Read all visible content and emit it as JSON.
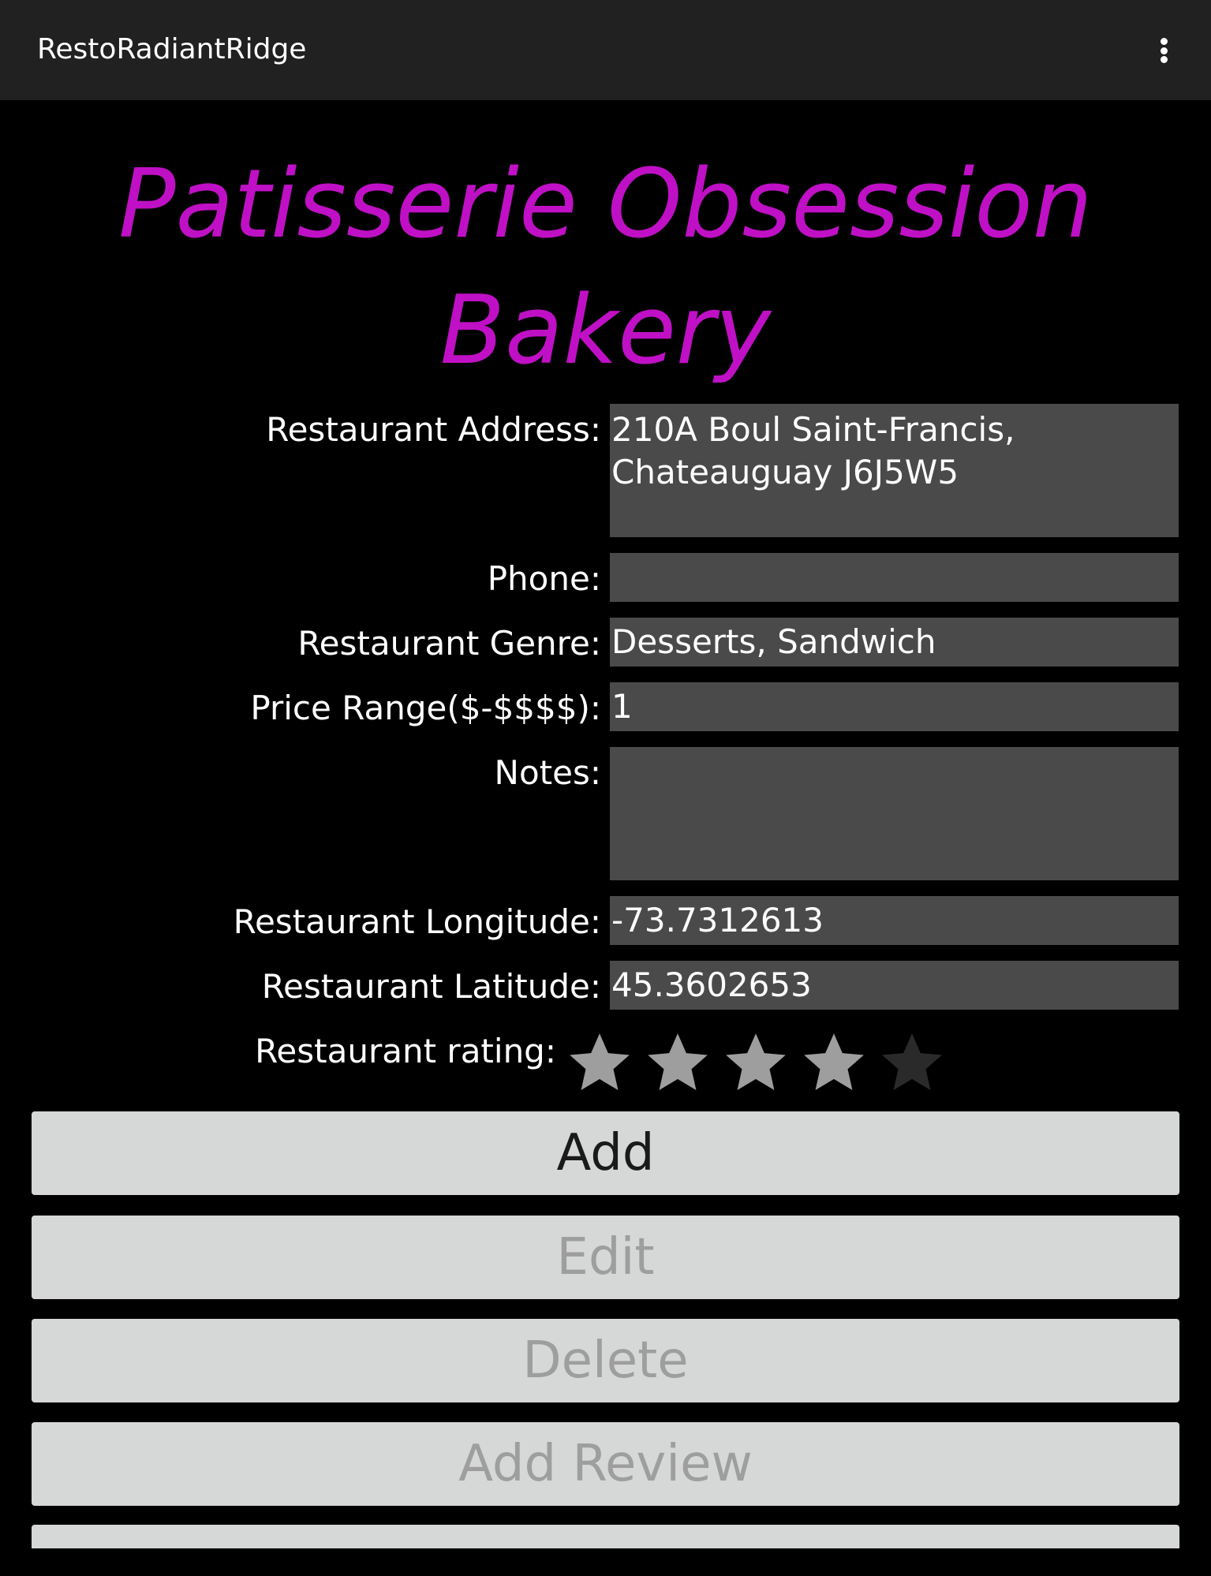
{
  "app": {
    "title": "RestoRadiantRidge"
  },
  "restaurant": {
    "name": "Patisserie Obsession Bakery"
  },
  "form": {
    "address_label": "Restaurant Address:",
    "address_value": "210A Boul Saint-Francis, Chateauguay J6J5W5",
    "phone_label": "Phone:",
    "phone_value": "",
    "genre_label": "Restaurant Genre:",
    "genre_value": "Desserts, Sandwich",
    "price_label": "Price Range($-$$$$):",
    "price_value": "1",
    "notes_label": "Notes:",
    "notes_value": "",
    "longitude_label": "Restaurant Longitude:",
    "longitude_value": "-73.7312613",
    "latitude_label": "Restaurant Latitude:",
    "latitude_value": "45.3602653",
    "rating_label": "Restaurant rating:",
    "rating_value": 4,
    "rating_max": 5
  },
  "buttons": {
    "add": "Add",
    "edit": "Edit",
    "delete": "Delete",
    "add_review": "Add Review"
  },
  "colors": {
    "title": "#c010c6",
    "star_filled": "#9e9e9e",
    "star_empty": "#2a2a2a"
  },
  "icons": {
    "overflow": "more-vert-icon",
    "star": "star-icon"
  }
}
